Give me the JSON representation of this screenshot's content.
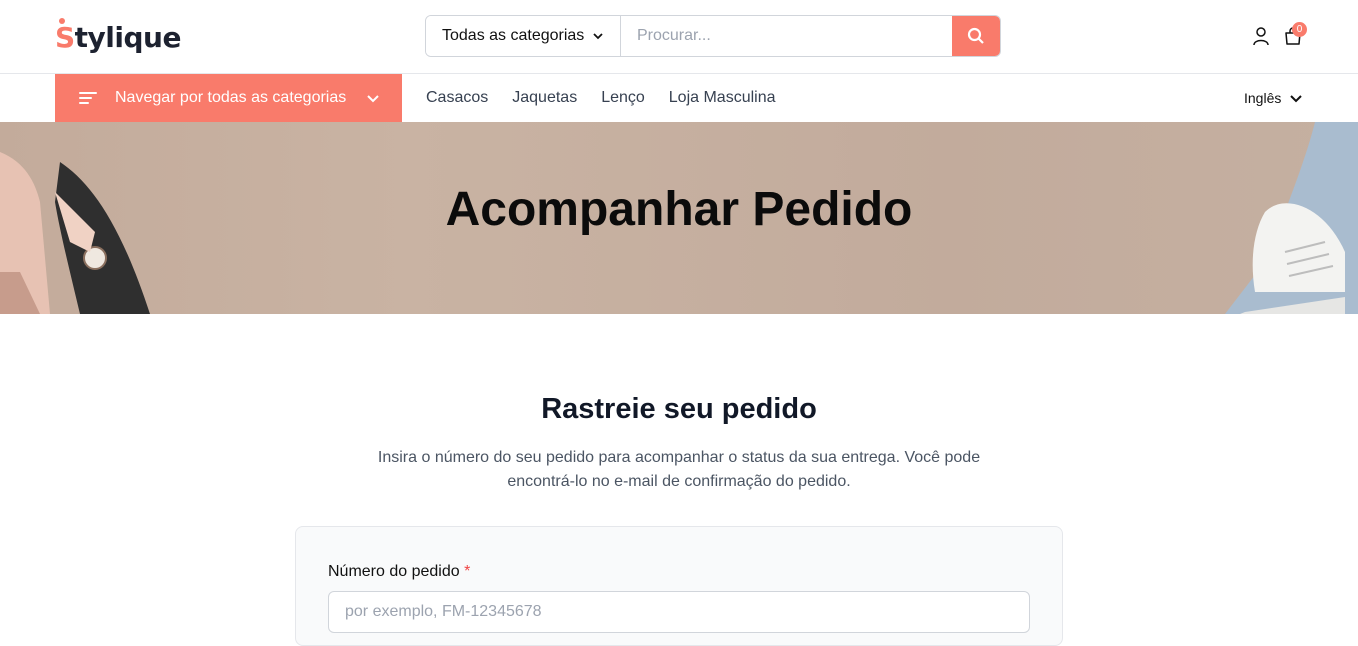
{
  "brand": {
    "logo_first": "S",
    "logo_rest": "tylique",
    "accent": "#f97b6b"
  },
  "header": {
    "category_select": "Todas as categorias",
    "search_placeholder": "Procurar...",
    "cart_count": "0"
  },
  "nav": {
    "browse_label": "Navegar por todas as categorias",
    "links": [
      "Casacos",
      "Jaquetas",
      "Lenço",
      "Loja Masculina"
    ],
    "language": "Inglês"
  },
  "hero": {
    "title": "Acompanhar Pedido"
  },
  "main": {
    "title": "Rastreie seu pedido",
    "description": "Insira o número do seu pedido para acompanhar o status da sua entrega. Você pode encontrá-lo no e-mail de confirmação do pedido.",
    "order_label": "Número do pedido",
    "required_mark": "*",
    "order_placeholder": "por exemplo, FM-12345678"
  }
}
